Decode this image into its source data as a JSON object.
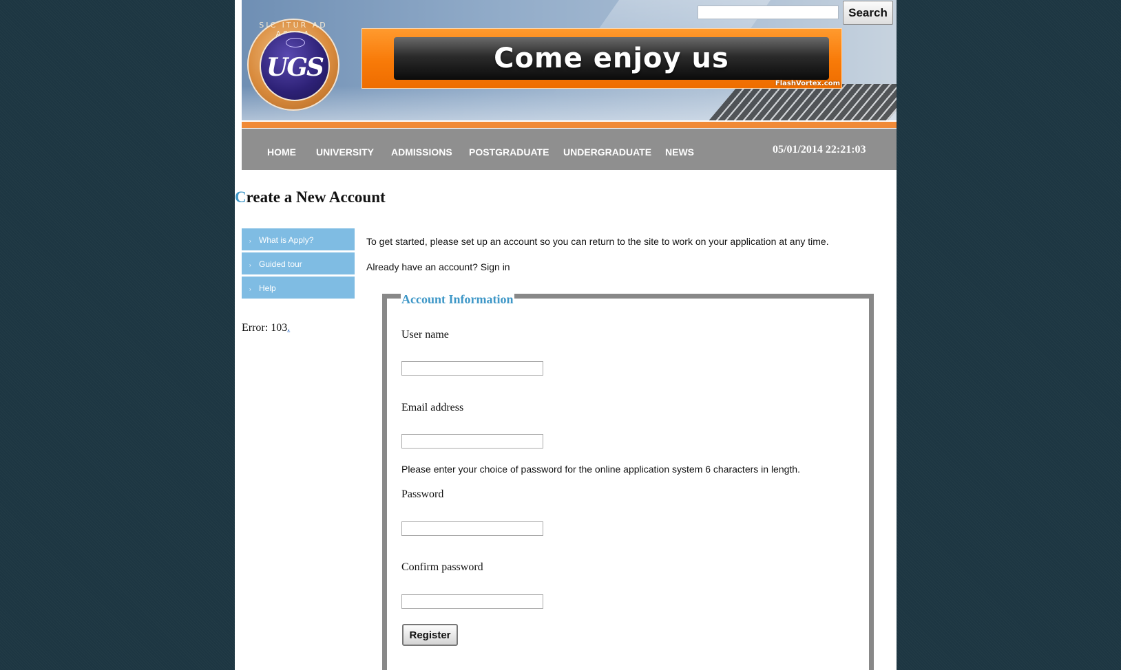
{
  "header": {
    "logo": {
      "motto": "SIC ITUR AD ASTRA",
      "monogram": "UGS"
    },
    "banner": {
      "headline": "Come enjoy us",
      "credit": "FlashVortex.com"
    },
    "search": {
      "value": "",
      "button_label": "Search"
    }
  },
  "nav": {
    "items": [
      "HOME",
      "UNIVERSITY",
      "ADMISSIONS",
      "POSTGRADUATE",
      "UNDERGRADUATE",
      "NEWS"
    ],
    "clock": "05/01/2014 22:21:03"
  },
  "page": {
    "title_first_letter": "C",
    "title_rest": "reate a New Account"
  },
  "side_menu": {
    "items": [
      {
        "label": "What is Apply?",
        "arrow": "›"
      },
      {
        "label": "Guided tour",
        "arrow": "›"
      },
      {
        "label": "Help",
        "arrow": "›"
      }
    ]
  },
  "error": {
    "text": "Error: 103",
    "suffix": "."
  },
  "intro": {
    "text": "To get started, please set up an account so you can return to the site to work on your application at any time.",
    "signin_prefix": "Already have an account?",
    "signin_link": "Sign in"
  },
  "form": {
    "legend": "Account Information",
    "username_label": "User name",
    "username_value": "",
    "email_label": "Email address",
    "email_value": "",
    "password_note": "Please enter your choice of password for the online application system 6 characters in length.",
    "password_label": "Password",
    "password_value": "",
    "confirm_label": "Confirm password",
    "confirm_value": "",
    "register_label": "Register"
  },
  "colors": {
    "background": "#1d3642",
    "nav_bar": "#8f8f8f",
    "accent_orange": "#f08a37",
    "side_menu": "#7fbce3",
    "legend_blue": "#3e97c7",
    "fieldset_border": "#888888"
  }
}
